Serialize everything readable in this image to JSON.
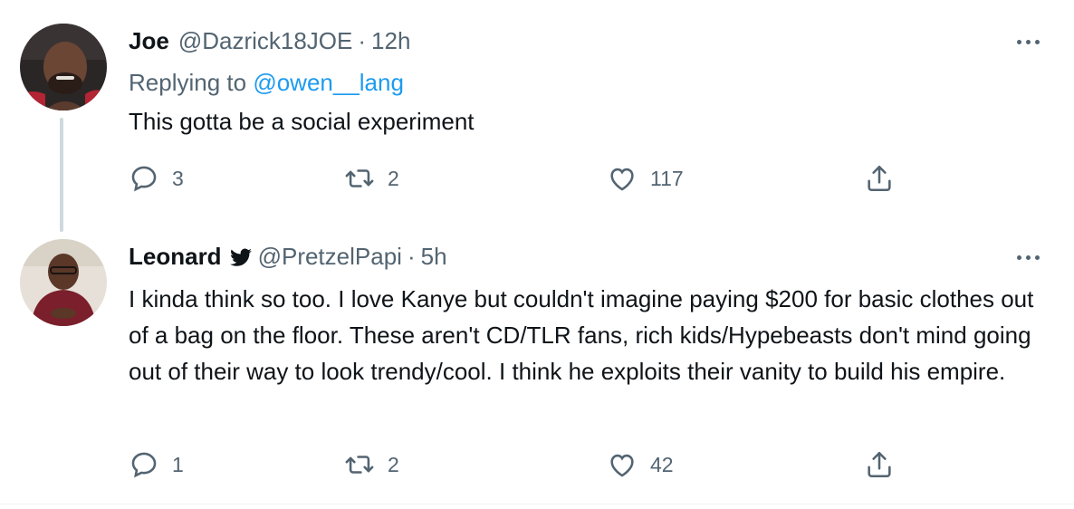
{
  "tweets": [
    {
      "name": "Joe",
      "handle": "@Dazrick18JOE",
      "separator": "·",
      "time": "12h",
      "replying_prefix": "Replying to",
      "replying_to": "@owen__lang",
      "text": "This gotta be a social experiment",
      "reply_count": "3",
      "retweet_count": "2",
      "like_count": "117",
      "verified": false
    },
    {
      "name": "Leonard",
      "handle": "@PretzelPapi",
      "separator": "·",
      "time": "5h",
      "text": "I kinda think so too. I love Kanye but couldn't imagine paying $200 for basic clothes out of a bag on the floor. These aren't CD/TLR fans, rich kids/Hypebeasts don't mind going out of their way to look trendy/cool. I think he exploits their vanity to build his empire.",
      "reply_count": "1",
      "retweet_count": "2",
      "like_count": "42",
      "verified": true
    }
  ],
  "colors": {
    "text": "#0f1419",
    "secondary": "#536471",
    "link": "#1d9bf0",
    "thread_line": "#cfd9de"
  },
  "icons": [
    "reply-icon",
    "retweet-icon",
    "like-icon",
    "share-icon",
    "more-icon",
    "twitter-bird-icon"
  ]
}
